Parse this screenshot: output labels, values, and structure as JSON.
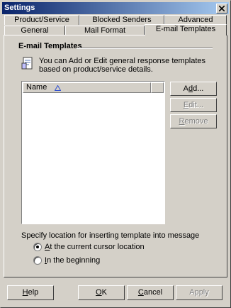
{
  "window": {
    "title": "Settings"
  },
  "tabs": {
    "row1": [
      {
        "label": "Product/Service"
      },
      {
        "label": "Blocked Senders"
      },
      {
        "label": "Advanced"
      }
    ],
    "row2": [
      {
        "label": "General"
      },
      {
        "label": "Mail Format"
      },
      {
        "label": "E-mail Templates"
      }
    ],
    "active": "E-mail Templates"
  },
  "section": {
    "title": "E-mail Templates",
    "info": "You can Add or Edit general response templates based on product/service details."
  },
  "list": {
    "columns": [
      {
        "label": "Name"
      }
    ],
    "rows": []
  },
  "side_buttons": {
    "add": {
      "pre": "A",
      "mnemonic": "d",
      "post": "d..."
    },
    "edit": {
      "pre": "",
      "mnemonic": "E",
      "post": "dit..."
    },
    "remove": {
      "pre": "",
      "mnemonic": "R",
      "post": "emove"
    }
  },
  "location": {
    "prompt": "Specify location for inserting template into message",
    "options": [
      {
        "pre": "",
        "mnemonic": "A",
        "post": "t the current cursor location",
        "selected": true
      },
      {
        "pre": "",
        "mnemonic": "I",
        "post": "n the beginning",
        "selected": false
      }
    ]
  },
  "footer": {
    "help": {
      "pre": "",
      "mnemonic": "H",
      "post": "elp"
    },
    "ok": {
      "pre": "",
      "mnemonic": "O",
      "post": "K"
    },
    "cancel": {
      "pre": "",
      "mnemonic": "C",
      "post": "ancel"
    },
    "apply": {
      "pre": "",
      "mnemonic": "",
      "post": "Apply"
    }
  },
  "colors": {
    "face": "#d4d0c8",
    "title_start": "#0a246a",
    "title_end": "#a6caf0",
    "shadow": "#808080"
  }
}
